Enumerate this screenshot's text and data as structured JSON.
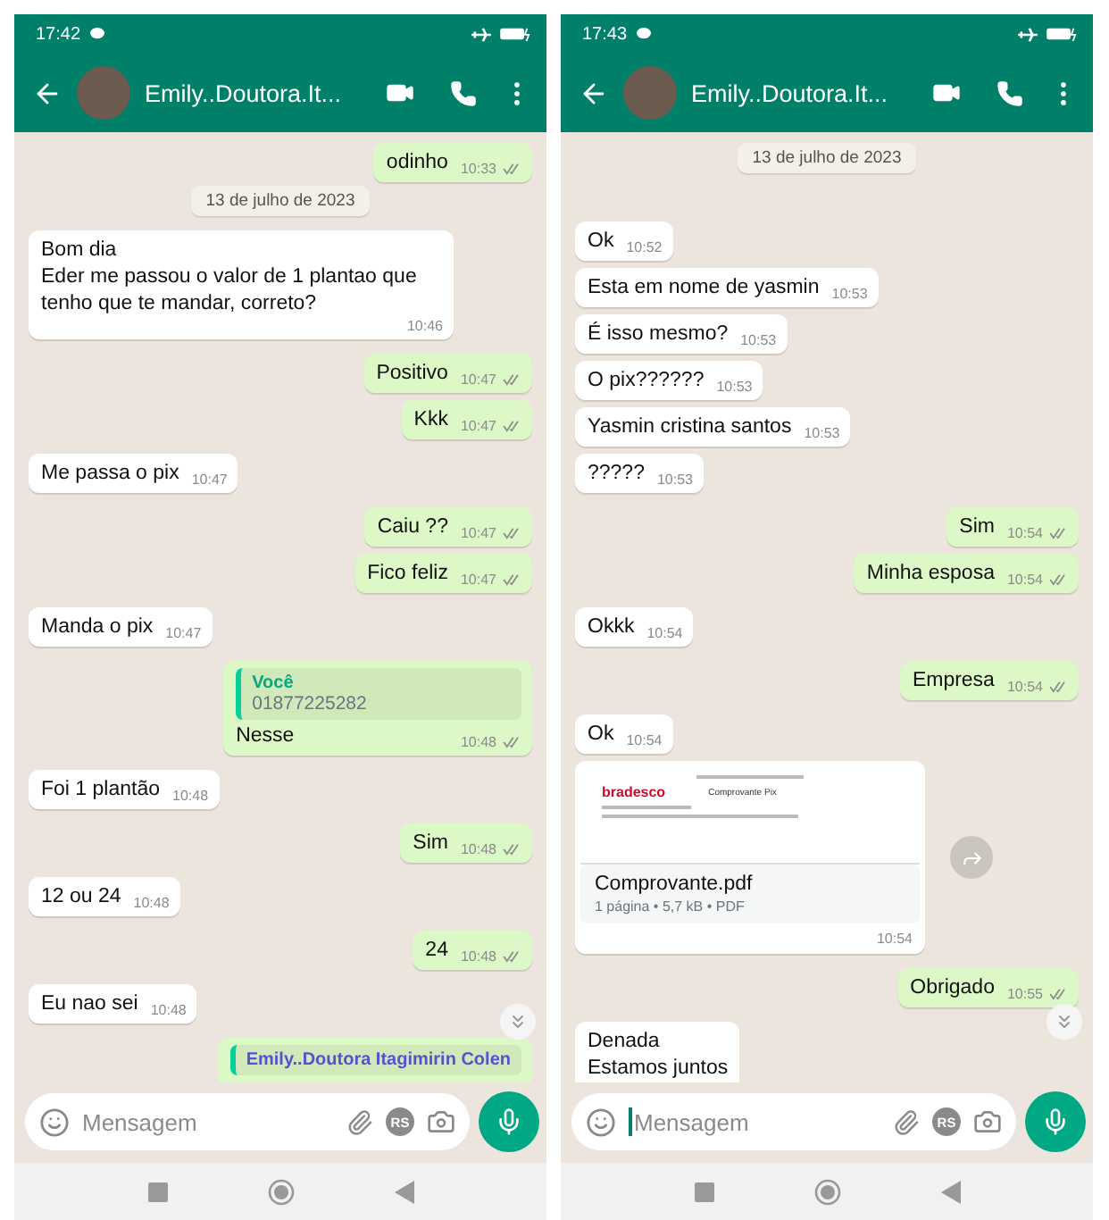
{
  "phones": [
    {
      "status_bar": {
        "time": "17:42"
      },
      "header": {
        "name": "Emily..Doutora.It..."
      },
      "scroll_down": true,
      "messages": [
        {
          "kind": "text",
          "outgoing": true,
          "text": "odinho",
          "time": "10:33"
        },
        {
          "kind": "date",
          "text": "13 de julho de 2023"
        },
        {
          "kind": "text",
          "outgoing": false,
          "text": "Bom dia\nEder me passou o valor de 1 plantao que tenho que te mandar, correto?",
          "time": "10:46"
        },
        {
          "kind": "text",
          "outgoing": true,
          "text": "Positivo",
          "time": "10:47"
        },
        {
          "kind": "text",
          "outgoing": true,
          "text": "Kkk",
          "time": "10:47"
        },
        {
          "kind": "text",
          "outgoing": false,
          "text": "Me passa o pix",
          "time": "10:47"
        },
        {
          "kind": "text",
          "outgoing": true,
          "text": "Caiu ??",
          "time": "10:47"
        },
        {
          "kind": "text",
          "outgoing": true,
          "text": "Fico feliz",
          "time": "10:47"
        },
        {
          "kind": "text",
          "outgoing": false,
          "text": "Manda o pix",
          "time": "10:47"
        },
        {
          "kind": "reply",
          "outgoing": true,
          "quote_author": "Você",
          "quote_text": "01877225282",
          "text": "Nesse",
          "time": "10:48"
        },
        {
          "kind": "text",
          "outgoing": false,
          "text": "Foi 1 plantão",
          "time": "10:48"
        },
        {
          "kind": "text",
          "outgoing": true,
          "text": "Sim",
          "time": "10:48"
        },
        {
          "kind": "text",
          "outgoing": false,
          "text": "12 ou 24",
          "time": "10:48"
        },
        {
          "kind": "text",
          "outgoing": true,
          "text": "24",
          "time": "10:48"
        },
        {
          "kind": "text",
          "outgoing": false,
          "text": "Eu nao sei",
          "time": "10:48"
        },
        {
          "kind": "partial_reply",
          "outgoing": true,
          "quote_author": "Emily..Doutora Itagimirin Colen"
        }
      ],
      "composer": {
        "placeholder": "Mensagem",
        "focused": false,
        "badge": "RS"
      }
    },
    {
      "status_bar": {
        "time": "17:43"
      },
      "header": {
        "name": "Emily..Doutora.It..."
      },
      "scroll_down": true,
      "messages": [
        {
          "kind": "date",
          "text": "13 de julho de 2023"
        },
        {
          "kind": "text",
          "outgoing": false,
          "text": "Ok",
          "time": "10:52"
        },
        {
          "kind": "text",
          "outgoing": false,
          "text": "Esta em nome de yasmin",
          "time": "10:53"
        },
        {
          "kind": "text",
          "outgoing": false,
          "text": "É isso mesmo?",
          "time": "10:53"
        },
        {
          "kind": "text",
          "outgoing": false,
          "text": "O pix??????",
          "time": "10:53"
        },
        {
          "kind": "text",
          "outgoing": false,
          "text": "Yasmin cristina santos",
          "time": "10:53"
        },
        {
          "kind": "text",
          "outgoing": false,
          "text": "?????",
          "time": "10:53"
        },
        {
          "kind": "text",
          "outgoing": true,
          "text": "Sim",
          "time": "10:54"
        },
        {
          "kind": "text",
          "outgoing": true,
          "text": "Minha esposa",
          "time": "10:54"
        },
        {
          "kind": "text",
          "outgoing": false,
          "text": "Okkk",
          "time": "10:54"
        },
        {
          "kind": "text",
          "outgoing": true,
          "text": "Empresa",
          "time": "10:54"
        },
        {
          "kind": "text",
          "outgoing": false,
          "text": "Ok",
          "time": "10:54"
        },
        {
          "kind": "document",
          "outgoing": false,
          "preview_logo": "bradesco",
          "preview_title": "Comprovante Pix",
          "filename": "Comprovante.pdf",
          "meta": "1 página • 5,7 kB • PDF",
          "time": "10:54"
        },
        {
          "kind": "text",
          "outgoing": true,
          "text": "Obrigado",
          "time": "10:55"
        },
        {
          "kind": "partial_text",
          "outgoing": false,
          "text": "Denada\nEstamos juntos"
        }
      ],
      "composer": {
        "placeholder": "Mensagem",
        "focused": true,
        "badge": "RS"
      }
    }
  ]
}
